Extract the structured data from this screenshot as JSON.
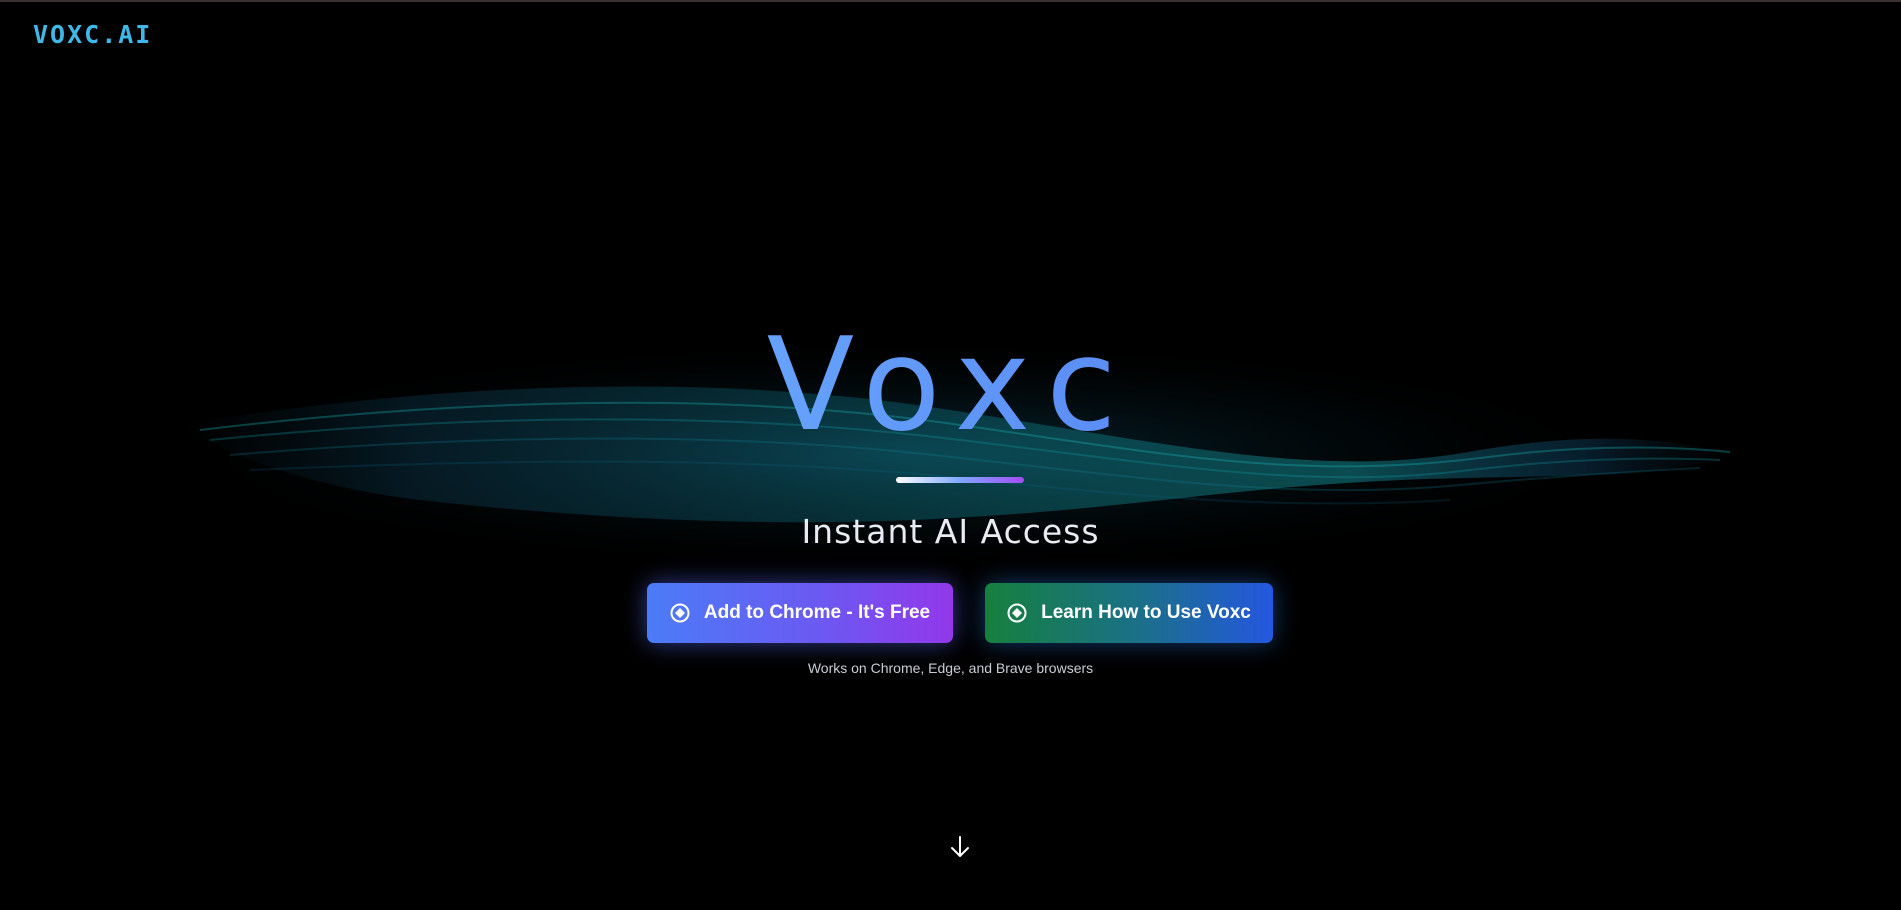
{
  "header": {
    "logo_text": "VOXC.AI"
  },
  "hero": {
    "title": "Voxc",
    "subtitle": "Instant AI Access"
  },
  "actions": {
    "add_to_chrome_label": "Add to Chrome - It's Free",
    "learn_label": "Learn How to Use Voxc",
    "note": "Works on Chrome, Edge, and Brave browsers"
  },
  "icons": {
    "button_icon": "chrome-icon",
    "scroll_icon": "arrow-down-icon"
  },
  "colors": {
    "background": "#000000",
    "logo": "#3fb8e8",
    "primary_gradient_start": "#4b7cf7",
    "primary_gradient_end": "#9338ea",
    "secondary_gradient_start": "#15803d",
    "secondary_gradient_end": "#2457e0",
    "wave": "#1aa6a6"
  }
}
